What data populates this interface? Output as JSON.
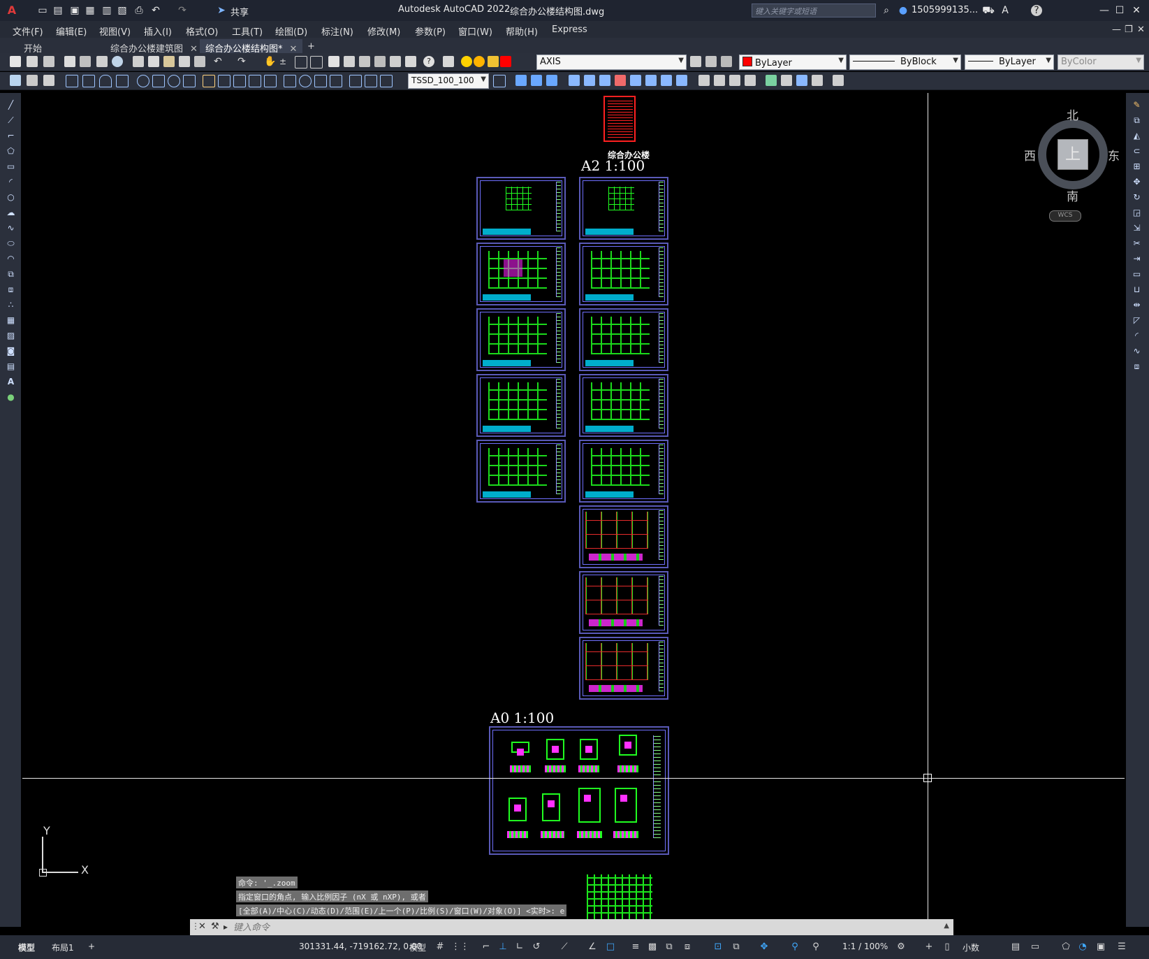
{
  "title": {
    "app": "Autodesk AutoCAD 2022",
    "file": "综合办公楼结构图.dwg",
    "share": "共享",
    "search_placeholder": "键入关键字或短语",
    "user": "1505999135...",
    "help": "?"
  },
  "menu": [
    "文件(F)",
    "编辑(E)",
    "视图(V)",
    "插入(I)",
    "格式(O)",
    "工具(T)",
    "绘图(D)",
    "标注(N)",
    "修改(M)",
    "参数(P)",
    "窗口(W)",
    "帮助(H)",
    "Express"
  ],
  "tabs": [
    {
      "label": "开始",
      "active": false
    },
    {
      "label": "综合办公楼建筑图",
      "active": false
    },
    {
      "label": "综合办公楼结构图*",
      "active": true
    }
  ],
  "toolbar": {
    "layer": "AXIS",
    "color": "ByLayer",
    "linetype": "ByBlock",
    "lineweight": "ByLayer",
    "plotstyle": "ByColor",
    "dimstyle": "TSSD_100_100"
  },
  "colors": {
    "layer_swatch": "#ff0000",
    "background": "#000000",
    "accent": "#3fa9ff"
  },
  "drawing": {
    "header_title": "综合办公楼",
    "label_a2": "A2 1:100",
    "label_a0": "A0 1:100"
  },
  "viewcube": {
    "top": "上",
    "north": "北",
    "south": "南",
    "east": "东",
    "west": "西",
    "wcs": "WCS"
  },
  "ucs": {
    "x": "X",
    "y": "Y"
  },
  "command": {
    "history": [
      "命令: '_.zoom",
      "指定窗口的角点, 输入比例因子 (nX 或 nXP), 或者",
      "[全部(A)/中心(C)/动态(D)/范围(E)/上一个(P)/比例(S)/窗口(W)/对象(O)] <实时>:  e"
    ],
    "placeholder": "键入命令"
  },
  "status": {
    "layout_tabs": [
      "模型",
      "布局1"
    ],
    "coords": "301331.44, -719162.72, 0.00",
    "space": "模型",
    "scale": "1:1 / 100%",
    "units": "小数"
  }
}
